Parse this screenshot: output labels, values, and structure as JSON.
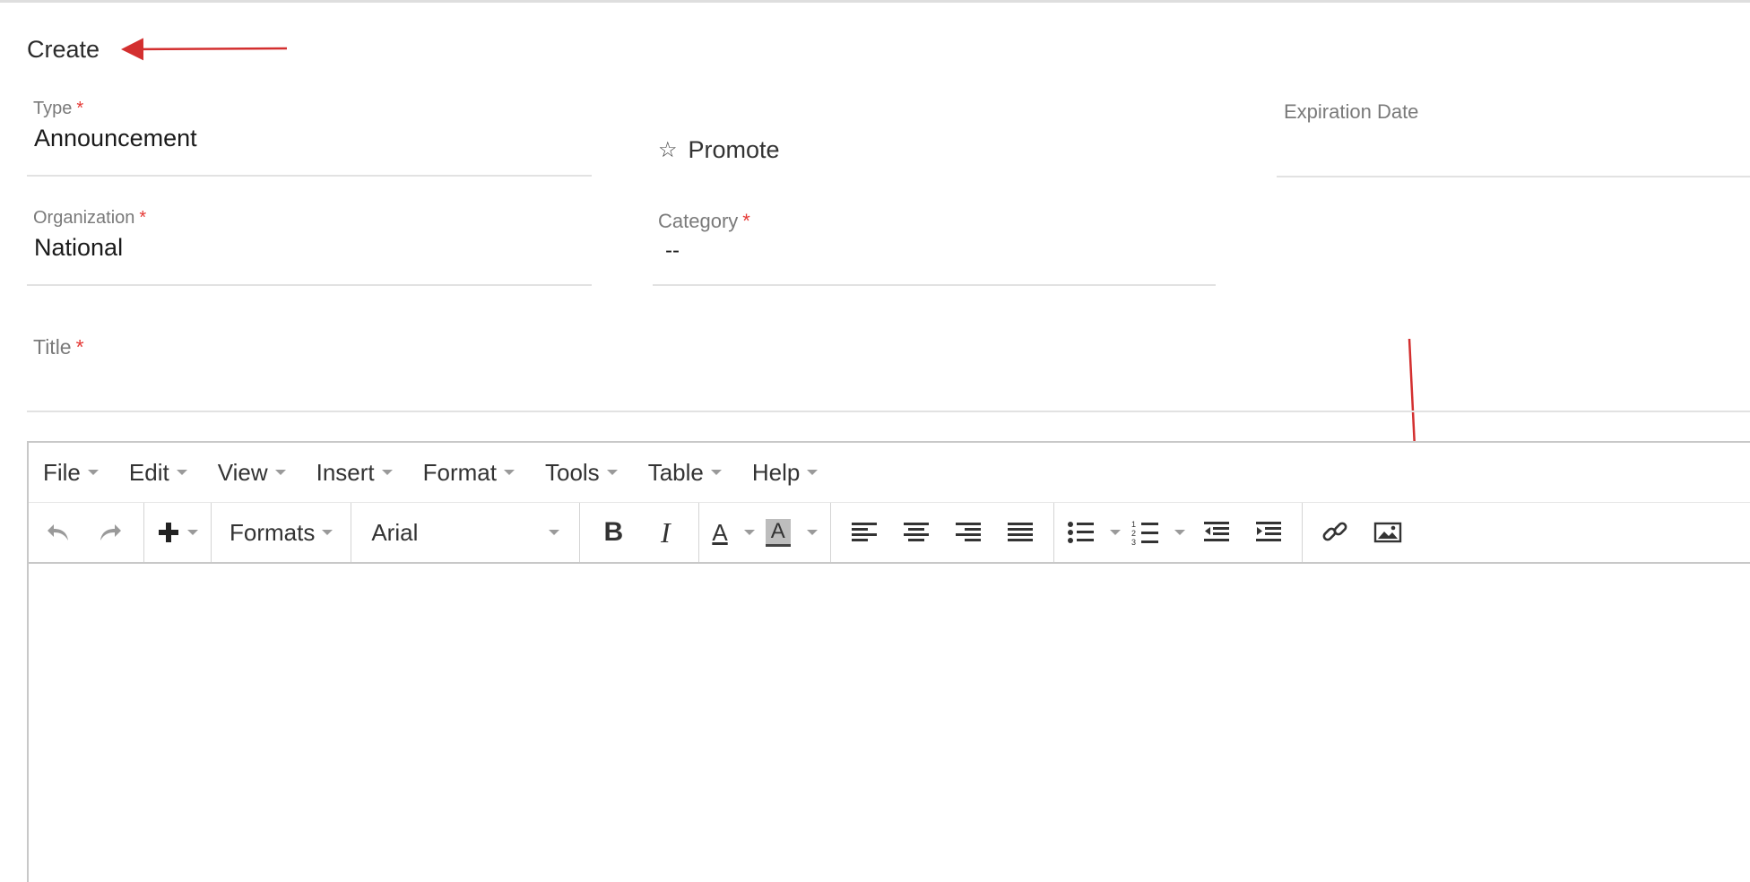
{
  "page": {
    "title": "Create"
  },
  "form": {
    "type": {
      "label": "Type",
      "value": "Announcement"
    },
    "promote": {
      "label": "Promote"
    },
    "expiration_date": {
      "label": "Expiration Date"
    },
    "organization": {
      "label": "Organization",
      "value": "National"
    },
    "category": {
      "label": "Category",
      "value": "--"
    },
    "title": {
      "label": "Title"
    },
    "required_marker": "*"
  },
  "editor": {
    "menu": [
      "File",
      "Edit",
      "View",
      "Insert",
      "Format",
      "Tools",
      "Table",
      "Help"
    ],
    "toolbar": {
      "formats_label": "Formats",
      "font_value": "Arial",
      "bold_glyph": "B",
      "italic_glyph": "I",
      "text_color_glyph": "A",
      "bg_color_glyph": "A"
    }
  },
  "colors": {
    "required": "#e53935",
    "annotation_arrow": "#d32f2f"
  }
}
